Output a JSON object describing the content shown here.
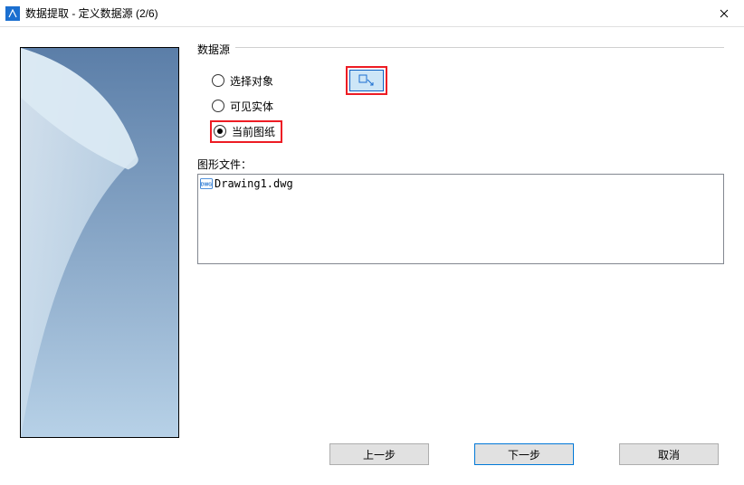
{
  "title": "数据提取 - 定义数据源 (2/6)",
  "datasource": {
    "group_label": "数据源",
    "options": {
      "select_objects": "选择对象",
      "visible_entities": "可见实体",
      "current_drawing": "当前图纸"
    },
    "selected": "current_drawing"
  },
  "files": {
    "label": "图形文件：",
    "items": [
      "Drawing1.dwg"
    ]
  },
  "buttons": {
    "prev": "上一步",
    "next": "下一步",
    "cancel": "取消"
  }
}
